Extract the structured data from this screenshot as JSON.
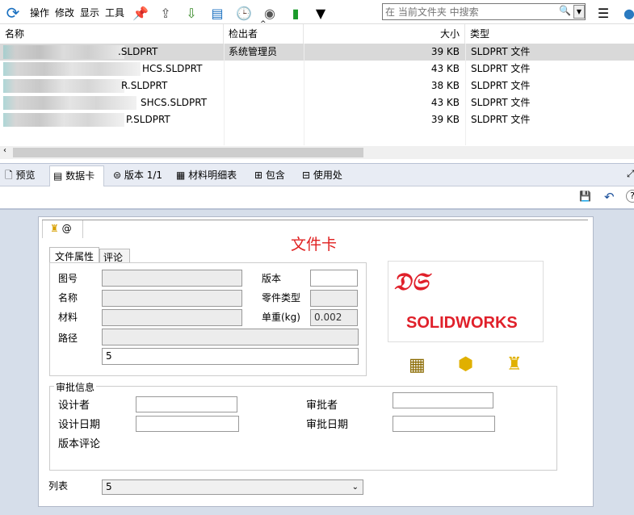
{
  "toolbar": {
    "menus": [
      "操作",
      "修改",
      "显示",
      "工具"
    ],
    "search_placeholder": "在 当前文件夹 中搜索"
  },
  "columns": {
    "name": "名称",
    "checked_out_by": "检出者",
    "size": "大小",
    "type": "类型"
  },
  "files": [
    {
      "name": ".SLDPRT",
      "checked_out_by": "系统管理员",
      "size": "39 KB",
      "type": "SLDPRT 文件"
    },
    {
      "name": "HCS.SLDPRT",
      "checked_out_by": "",
      "size": "43 KB",
      "type": "SLDPRT 文件"
    },
    {
      "name": "R.SLDPRT",
      "checked_out_by": "",
      "size": "38 KB",
      "type": "SLDPRT 文件"
    },
    {
      "name": "SHCS.SLDPRT",
      "checked_out_by": "",
      "size": "43 KB",
      "type": "SLDPRT 文件"
    },
    {
      "name": "P.SLDPRT",
      "checked_out_by": "",
      "size": "39 KB",
      "type": "SLDPRT 文件"
    }
  ],
  "tabs": [
    "预览",
    "数据卡",
    "版本 1/1",
    "材料明细表",
    "包含",
    "使用处"
  ],
  "card": {
    "tab": "@",
    "title": "文件卡",
    "subtabs": [
      "文件属性",
      "评论"
    ],
    "fields": {
      "part_no": "图号",
      "name": "名称",
      "material": "材料",
      "path": "路径",
      "path_value": "5",
      "version": "版本",
      "part_type": "零件类型",
      "weight": "单重(kg)",
      "weight_value": "0.002"
    },
    "logo": "SOLIDWORKS",
    "approval": {
      "title": "审批信息",
      "designer": "设计者",
      "design_date": "设计日期",
      "version_comment": "版本评论",
      "approver": "审批者",
      "approve_date": "审批日期"
    },
    "list_label": "列表",
    "list_value": "5"
  }
}
